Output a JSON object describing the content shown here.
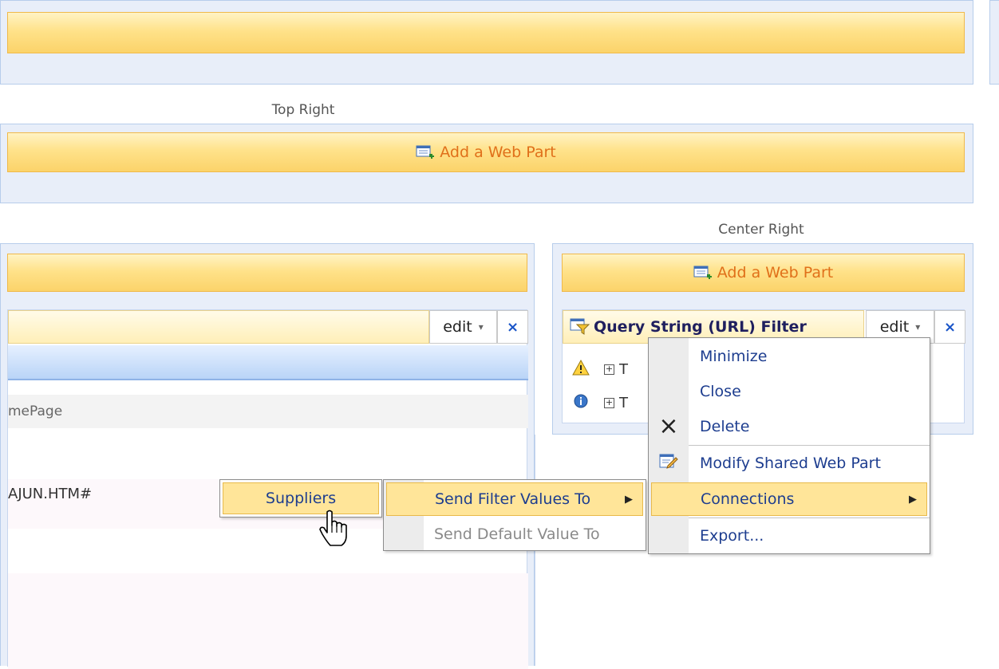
{
  "zones": {
    "top_right_label": "Top Right",
    "center_right_label": "Center Right",
    "add_web_part_label": "Add a Web Part"
  },
  "left_webpart": {
    "edit_label": "edit",
    "edit_arrow": "▾",
    "close_label": "×",
    "row1_text": "mePage",
    "row2_text": "AJUN.HTM#"
  },
  "filter_webpart": {
    "title": "Query String (URL) Filter",
    "edit_label": "edit",
    "edit_arrow": "▾",
    "close_label": "×",
    "item1_prefix": "T",
    "item2_prefix": "T"
  },
  "suppliers_menu": {
    "label": "Suppliers"
  },
  "send_menu": {
    "items": [
      {
        "label": "Send Filter Values To",
        "arrow": "▶"
      },
      {
        "label": "Send Default Value To"
      }
    ]
  },
  "edit_menu": {
    "items": [
      {
        "label": "Minimize"
      },
      {
        "label": "Close"
      },
      {
        "label": "Delete",
        "icon": "×"
      },
      {
        "label": "Modify Shared Web Part"
      },
      {
        "label": "Connections",
        "arrow": "▶"
      },
      {
        "label": "Export..."
      }
    ]
  },
  "colors": {
    "accent_orange": "#e0701a",
    "link_blue": "#1d3d8f",
    "zone_bg": "#e8eef9",
    "highlight": "#ffe599"
  }
}
